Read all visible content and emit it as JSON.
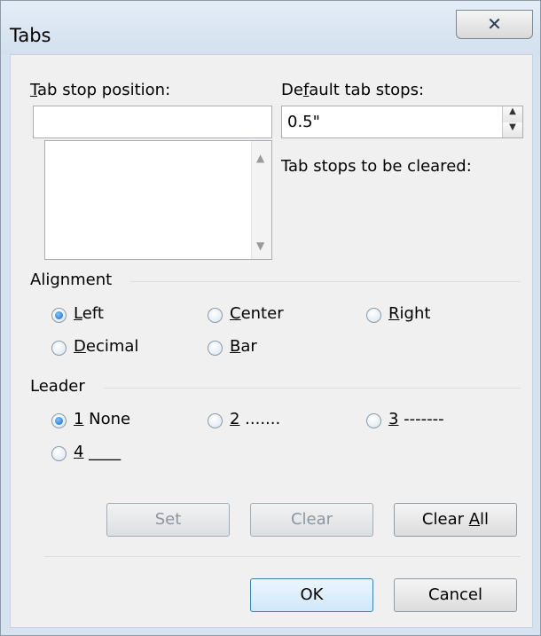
{
  "window": {
    "title": "Tabs",
    "close_glyph": "✕"
  },
  "tab_stop_position": {
    "label_prefix": "",
    "label_mnemonic": "T",
    "label_rest": "ab stop position:",
    "value": ""
  },
  "default_tab_stops": {
    "label_prefix": "De",
    "label_mnemonic": "f",
    "label_rest": "ault tab stops:",
    "value": "0.5\""
  },
  "tab_stops_to_be_cleared": {
    "label": "Tab stops to be cleared:"
  },
  "alignment": {
    "label": "Alignment",
    "options": [
      {
        "mnemonic": "L",
        "rest": "eft",
        "checked": true
      },
      {
        "mnemonic": "C",
        "rest": "enter",
        "checked": false
      },
      {
        "mnemonic": "R",
        "rest": "ight",
        "checked": false
      },
      {
        "mnemonic": "D",
        "rest": "ecimal",
        "checked": false
      },
      {
        "mnemonic": "B",
        "rest": "ar",
        "checked": false
      }
    ]
  },
  "leader": {
    "label": "Leader",
    "options": [
      {
        "mnemonic": "1",
        "rest": " None",
        "checked": true
      },
      {
        "mnemonic": "2",
        "rest": " .......",
        "checked": false
      },
      {
        "mnemonic": "3",
        "rest": " -------",
        "checked": false
      },
      {
        "mnemonic": "4",
        "rest": " ____",
        "checked": false
      }
    ]
  },
  "buttons": {
    "set": "Set",
    "clear": "Clear",
    "clear_all_prefix": "Clear ",
    "clear_all_mnemonic": "A",
    "clear_all_rest": "ll",
    "ok": "OK",
    "cancel": "Cancel"
  },
  "colors": {
    "radio_selected": "#1c67c7",
    "button_focus_border": "#3c7fb1"
  },
  "icons": {
    "close": "close-icon",
    "scroll_up": "scroll-up-arrow-icon",
    "scroll_down": "scroll-down-arrow-icon",
    "spin_up": "spin-up-arrow-icon",
    "spin_down": "spin-down-arrow-icon"
  }
}
